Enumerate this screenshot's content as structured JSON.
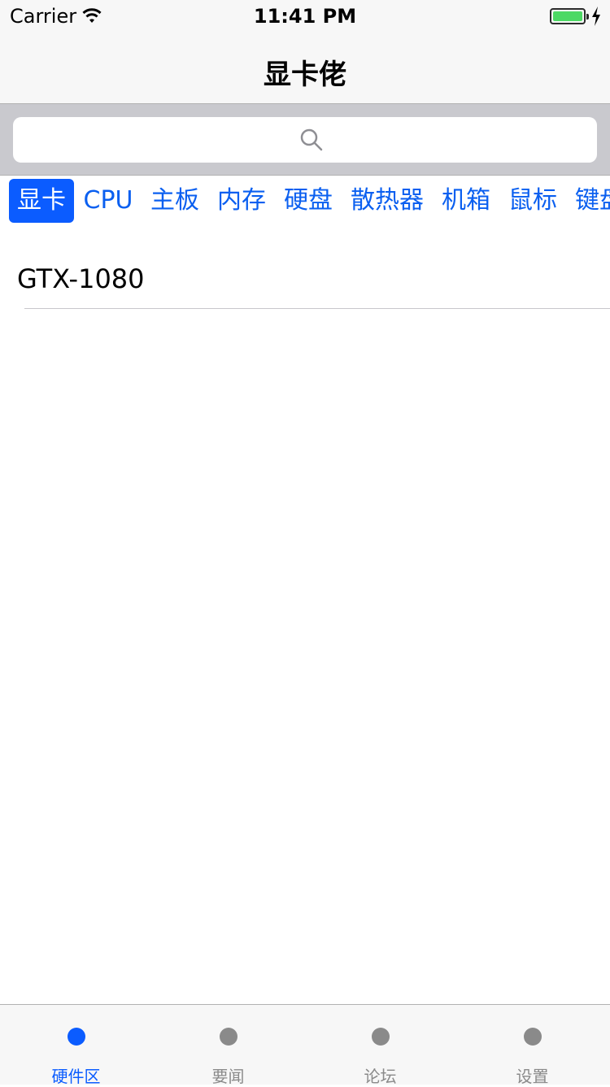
{
  "status_bar": {
    "carrier": "Carrier",
    "time": "11:41 PM"
  },
  "nav": {
    "title": "显卡佬"
  },
  "search": {
    "placeholder": ""
  },
  "categories": [
    {
      "label": "显卡",
      "active": true
    },
    {
      "label": "CPU"
    },
    {
      "label": "主板"
    },
    {
      "label": "内存"
    },
    {
      "label": "硬盘"
    },
    {
      "label": "散热器"
    },
    {
      "label": "机箱"
    },
    {
      "label": "鼠标"
    },
    {
      "label": "键盘"
    }
  ],
  "list": {
    "items": [
      {
        "label": "GTX-1080"
      }
    ]
  },
  "tab_bar": {
    "items": [
      {
        "label": "硬件区",
        "active": true
      },
      {
        "label": "要闻"
      },
      {
        "label": "论坛"
      },
      {
        "label": "设置"
      }
    ]
  },
  "colors": {
    "accent": "#0b5cff",
    "inactive": "#8a8a8a",
    "battery": "#4cd964"
  }
}
